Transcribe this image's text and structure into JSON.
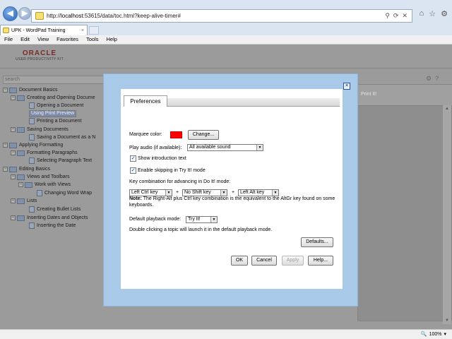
{
  "browser": {
    "url_prefix": "http://",
    "url_host": "localhost",
    "url_rest": ":53615/data/toc.html?keep-alive-timer#",
    "address_icons": [
      "search-icon",
      "refresh-icon",
      "close-icon"
    ],
    "toolbar_icons": [
      "home-icon",
      "star-icon",
      "gear-icon"
    ],
    "tab_title": "UPK - WordPad Training",
    "tab_close": "×"
  },
  "menu": [
    "File",
    "Edit",
    "View",
    "Favorites",
    "Tools",
    "Help"
  ],
  "app": {
    "logo_top": "ORACLE",
    "logo_sub": "USER PRODUCTIVITY KIT",
    "search_placeholder": "search",
    "right_header": "Print It!"
  },
  "tree": [
    {
      "label": "Document Basics",
      "kind": "book",
      "exp": "−"
    },
    {
      "label": "Creating and Opening Docume",
      "kind": "book",
      "exp": "−"
    },
    {
      "label": "Opening a Document",
      "kind": "topic",
      "exp": ""
    },
    {
      "label": "Using Print Preview",
      "kind": "topic",
      "exp": "",
      "selected": true
    },
    {
      "label": "Printing a Document",
      "kind": "topic",
      "exp": ""
    },
    {
      "label": "Saving Documents",
      "kind": "book",
      "exp": "−"
    },
    {
      "label": "Saving a Document as a N",
      "kind": "topic",
      "exp": ""
    },
    {
      "label": "Applying Formatting",
      "kind": "book",
      "exp": "−"
    },
    {
      "label": "Formatting Paragraphs",
      "kind": "book",
      "exp": "−"
    },
    {
      "label": "Selecting Paragraph Text",
      "kind": "topic",
      "exp": ""
    },
    {
      "label": "Editing Basics",
      "kind": "book",
      "exp": "−"
    },
    {
      "label": "Views and Toolbars",
      "kind": "book",
      "exp": "−"
    },
    {
      "label": "Work with Views",
      "kind": "book",
      "exp": "−"
    },
    {
      "label": "Changing Word Wrap",
      "kind": "topic",
      "exp": ""
    },
    {
      "label": "Lists",
      "kind": "book",
      "exp": "−"
    },
    {
      "label": "Creating Bullet Lists",
      "kind": "topic",
      "exp": ""
    },
    {
      "label": "Inserting Dates and Objects",
      "kind": "book",
      "exp": "−"
    },
    {
      "label": "Inserting the Date",
      "kind": "topic",
      "exp": ""
    }
  ],
  "dialog": {
    "close": "×",
    "tab": "Preferences",
    "marquee_label": "Marquee color:",
    "marquee_color": "#ff0000",
    "change_btn": "Change...",
    "audio_label": "Play audio (if available):",
    "audio_value": "All available sound",
    "show_intro_label": "Show introduction text",
    "show_intro_checked": true,
    "enable_skip_label": "Enable skipping in Try It! mode",
    "enable_skip_checked": true,
    "keycombo_label": "Key combination for advancing in Do It! mode:",
    "key1": "Left Ctrl key",
    "key2": "No Shift key",
    "key3": "Left Alt key",
    "plus": "+",
    "note_bold": "Note:",
    "note_text": " The Right-Alt plus Ctrl key combination is the equivalent to the AltGr key found on some keyboards.",
    "playback_label": "Default playback mode:",
    "playback_value": "Try It!",
    "double_click_text": "Double clicking a topic will launch it in the default playback mode.",
    "defaults_btn": "Defaults...",
    "ok_btn": "OK",
    "cancel_btn": "Cancel",
    "apply_btn": "Apply",
    "help_btn": "Help..."
  },
  "status": {
    "zoom": "100%"
  }
}
